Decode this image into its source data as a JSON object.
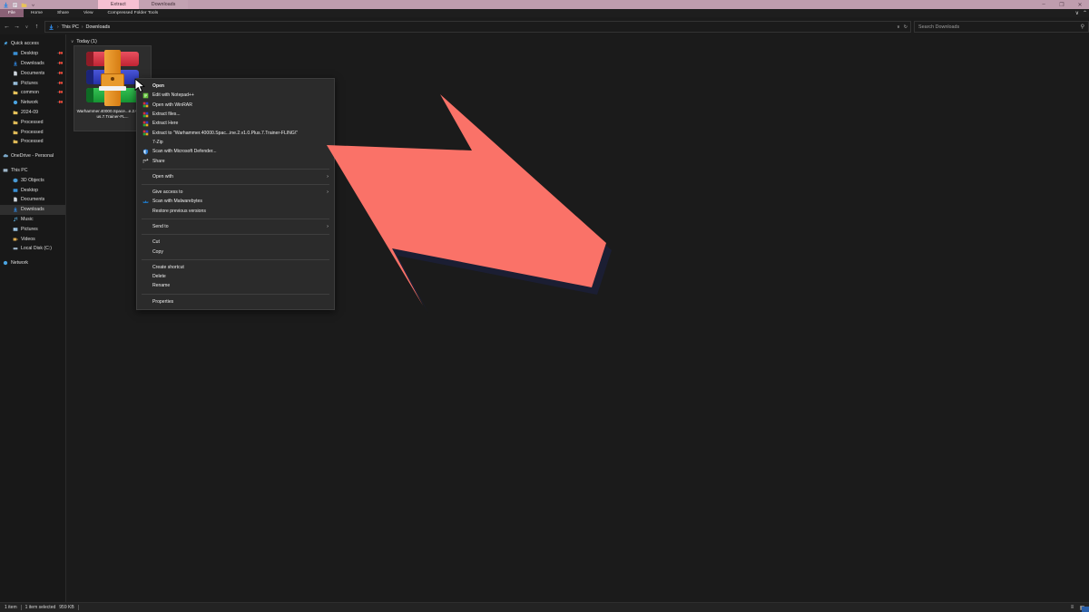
{
  "window": {
    "title": "Downloads",
    "quick_access_toolbar": [
      {
        "name": "downloads-icon",
        "glyph": "↓"
      },
      {
        "name": "properties-icon",
        "glyph": "▤"
      },
      {
        "name": "new-folder-icon",
        "glyph": "▮"
      },
      {
        "name": "customize-dropdown-icon",
        "glyph": "▾"
      }
    ],
    "title_tabs": [
      {
        "label": "Extract",
        "state": "active"
      },
      {
        "label": "Downloads",
        "state": "inactive"
      }
    ],
    "controls": [
      {
        "name": "minimize-button",
        "glyph": "–"
      },
      {
        "name": "maximize-button",
        "glyph": "❐"
      },
      {
        "name": "close-button",
        "glyph": "✕"
      }
    ]
  },
  "ribbon": {
    "tabs": [
      {
        "label": "File",
        "active": true
      },
      {
        "label": "Home",
        "active": false
      },
      {
        "label": "Share",
        "active": false
      },
      {
        "label": "View",
        "active": false
      },
      {
        "label": "Compressed Folder Tools",
        "active": false
      }
    ],
    "help_glyph": "∨",
    "expand_glyph": "⌃"
  },
  "address_bar": {
    "back_glyph": "←",
    "forward_glyph": "→",
    "recent_glyph": "∨",
    "up_glyph": "↑",
    "breadcrumb": [
      "This PC",
      "Downloads"
    ],
    "separator": "›",
    "dropdown_glyph": "∨",
    "refresh_glyph": "↻",
    "search": {
      "placeholder": "Search Downloads",
      "value": "",
      "icon": "search-icon",
      "icon_glyph": "⚲"
    }
  },
  "sidebar": {
    "sections": [
      {
        "name": "quick-access",
        "label": "Quick access",
        "icon": "pin-icon",
        "color": "#4aa3e0",
        "items": [
          {
            "label": "Desktop",
            "icon": "desktop-icon",
            "color": "#3a8fd4",
            "pinned": true
          },
          {
            "label": "Downloads",
            "icon": "downloads-icon",
            "color": "#2f86e0",
            "pinned": true
          },
          {
            "label": "Documents",
            "icon": "documents-icon",
            "color": "#cfd6dd",
            "pinned": true
          },
          {
            "label": "Pictures",
            "icon": "pictures-icon",
            "color": "#8fb7d6",
            "pinned": true
          },
          {
            "label": "common",
            "icon": "folder-icon",
            "color": "#e8c35a",
            "pinned": true
          },
          {
            "label": "Network",
            "icon": "network-icon",
            "color": "#4aa3e0",
            "pinned": true
          },
          {
            "label": "2024-09",
            "icon": "folder-icon",
            "color": "#e8c35a",
            "pinned": false
          },
          {
            "label": "Processed",
            "icon": "folder-icon",
            "color": "#e0bb57",
            "pinned": false
          },
          {
            "label": "Processed",
            "icon": "folder-icon",
            "color": "#e0bb57",
            "pinned": false
          },
          {
            "label": "Processed",
            "icon": "folder-icon",
            "color": "#e0bb57",
            "pinned": false
          }
        ]
      },
      {
        "name": "onedrive",
        "label": "OneDrive - Personal",
        "icon": "cloud-icon",
        "color": "#7aa7c7",
        "items": []
      },
      {
        "name": "this-pc",
        "label": "This PC",
        "icon": "computer-icon",
        "color": "#9db4c7",
        "items": [
          {
            "label": "3D Objects",
            "icon": "cube-icon",
            "color": "#4a9ad4",
            "selected": false
          },
          {
            "label": "Desktop",
            "icon": "desktop-icon",
            "color": "#3a8fd4",
            "selected": false
          },
          {
            "label": "Documents",
            "icon": "documents-icon",
            "color": "#cfd6dd",
            "selected": false
          },
          {
            "label": "Downloads",
            "icon": "downloads-icon",
            "color": "#2f86e0",
            "selected": true
          },
          {
            "label": "Music",
            "icon": "music-icon",
            "color": "#5ab4e8",
            "selected": false
          },
          {
            "label": "Pictures",
            "icon": "pictures-icon",
            "color": "#8fb7d6",
            "selected": false
          },
          {
            "label": "Videos",
            "icon": "video-icon",
            "color": "#d9a84e",
            "selected": false
          },
          {
            "label": "Local Disk (C:)",
            "icon": "drive-icon",
            "color": "#9db4c7",
            "selected": false
          }
        ]
      },
      {
        "name": "network",
        "label": "Network",
        "icon": "network-icon",
        "color": "#4aa3e0",
        "items": []
      }
    ]
  },
  "file_pane": {
    "group": {
      "chevron": "∨",
      "label": "Today (1)"
    },
    "items": [
      {
        "name": "rar-archive",
        "filename": "Warhammer.40000.Space...e.2.v1.0.Plus.7.Trainer-FL...",
        "icon": "winrar-archive-icon",
        "selected": true,
        "icon_bands": [
          {
            "body": "#d62f3e",
            "cap": "#9e1f2c"
          },
          {
            "body": "#2f3fc4",
            "cap": "#1f2a8c"
          },
          {
            "body": "#1fa83c",
            "cap": "#157a2a"
          }
        ],
        "strap_color": "#e08a1e"
      }
    ]
  },
  "context_menu": {
    "items": [
      {
        "label": "Open",
        "bold": true,
        "icon": null,
        "submenu": false
      },
      {
        "label": "Edit with Notepad++",
        "bold": false,
        "icon": "notepadpp-icon",
        "icon_color": "#63c13a",
        "submenu": false
      },
      {
        "label": "Open with WinRAR",
        "bold": false,
        "icon": "winrar-icon",
        "icon_color": "#d62f3e",
        "submenu": false
      },
      {
        "label": "Extract files...",
        "bold": false,
        "icon": "winrar-icon",
        "icon_color": "#d62f3e",
        "submenu": false
      },
      {
        "label": "Extract Here",
        "bold": false,
        "icon": "winrar-icon",
        "icon_color": "#d62f3e",
        "submenu": false
      },
      {
        "label": "Extract to \"Warhammer.40000.Spac...ine.2.v1.0.Plus.7.Trainer-FLING\\\"",
        "bold": false,
        "icon": "winrar-icon",
        "icon_color": "#d62f3e",
        "submenu": false
      },
      {
        "label": "7-Zip",
        "bold": false,
        "icon": null,
        "submenu": false
      },
      {
        "label": "Scan with Microsoft Defender...",
        "bold": false,
        "icon": "shield-icon",
        "icon_color": "#2f7fd4",
        "submenu": false
      },
      {
        "label": "Share",
        "bold": false,
        "icon": "share-icon",
        "icon_color": "#cfcfcf",
        "submenu": false
      },
      {
        "separator_before": true,
        "label": "Open with",
        "bold": false,
        "icon": null,
        "submenu": true
      },
      {
        "separator_before": true,
        "label": "Give access to",
        "bold": false,
        "icon": null,
        "submenu": true
      },
      {
        "label": "Scan with Malwarebytes",
        "bold": false,
        "icon": "malwarebytes-icon",
        "icon_color": "#1e7fd4",
        "submenu": false
      },
      {
        "label": "Restore previous versions",
        "bold": false,
        "icon": null,
        "submenu": false
      },
      {
        "separator_before": true,
        "label": "Send to",
        "bold": false,
        "icon": null,
        "submenu": true
      },
      {
        "separator_before": true,
        "label": "Cut",
        "bold": false,
        "icon": null,
        "submenu": false
      },
      {
        "label": "Copy",
        "bold": false,
        "icon": null,
        "submenu": false
      },
      {
        "separator_before": true,
        "label": "Create shortcut",
        "bold": false,
        "icon": null,
        "submenu": false
      },
      {
        "label": "Delete",
        "bold": false,
        "icon": null,
        "submenu": false
      },
      {
        "label": "Rename",
        "bold": false,
        "icon": null,
        "submenu": false
      },
      {
        "separator_before": true,
        "label": "Properties",
        "bold": false,
        "icon": null,
        "submenu": false
      }
    ],
    "submenu_glyph": "›"
  },
  "status_bar": {
    "item_count": "1 item",
    "selection": "1 item selected",
    "selection_size": "959 KB",
    "view_buttons": [
      {
        "name": "details-view-button",
        "glyph": "≡"
      },
      {
        "name": "large-icons-view-button",
        "glyph": "▦"
      }
    ]
  },
  "overlay": {
    "arrow": {
      "name": "annotation-arrow",
      "fill": "#fa7268",
      "shadow": "#1b1e33"
    },
    "cursor": {
      "name": "mouse-cursor",
      "fill": "#ffffff",
      "stroke": "#000000"
    }
  }
}
